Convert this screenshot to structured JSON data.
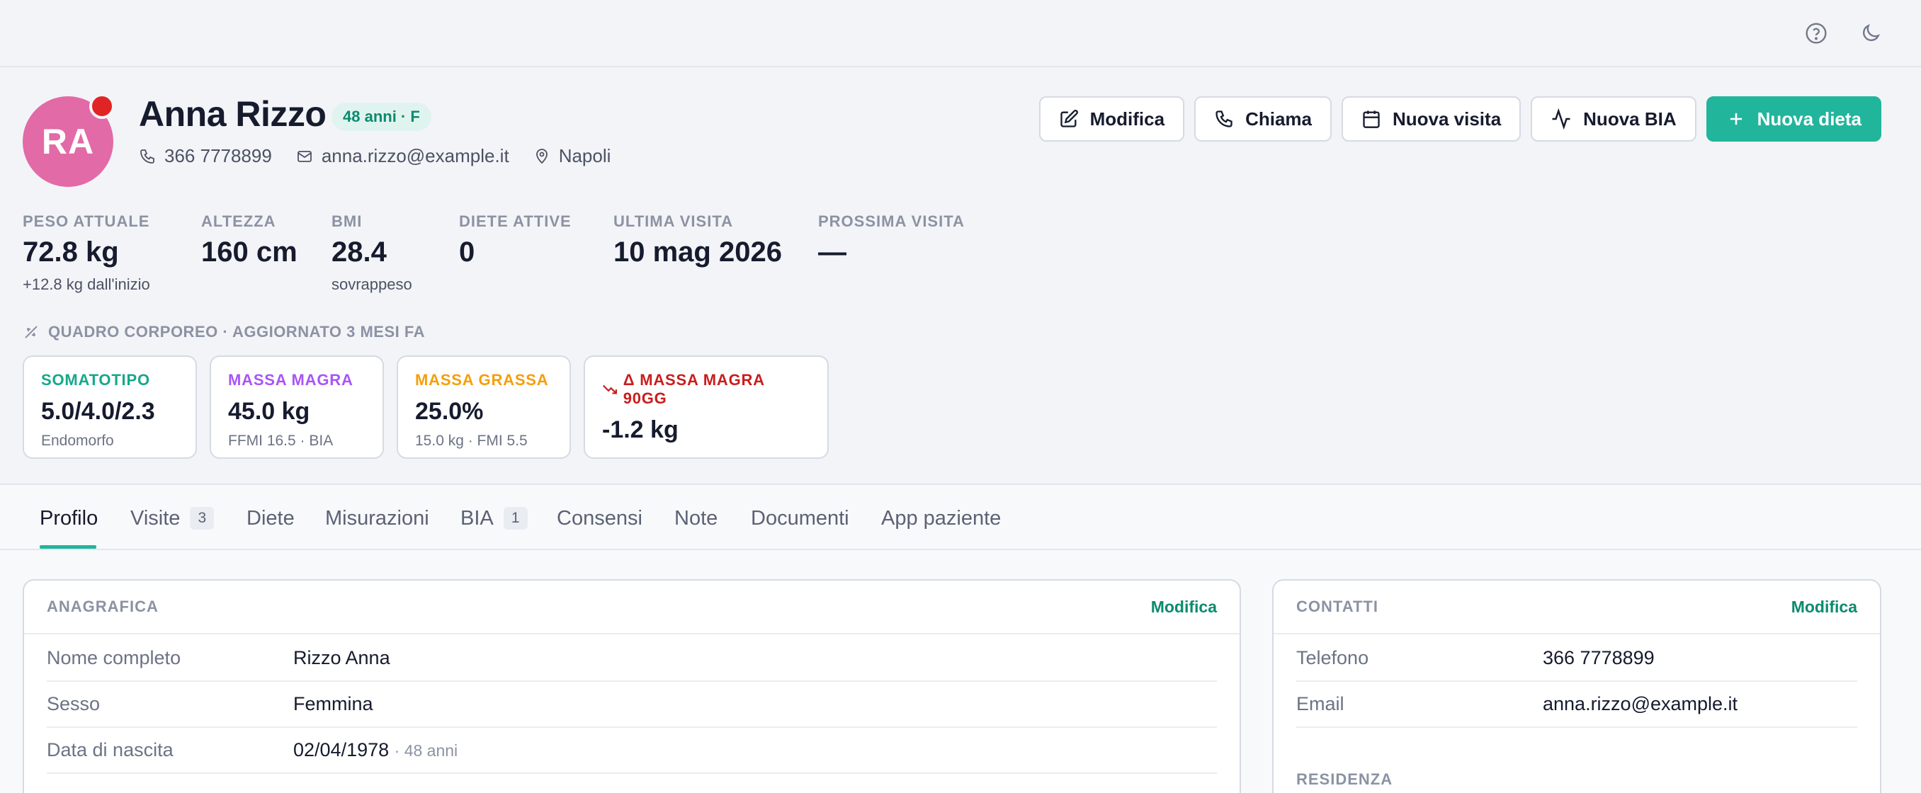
{
  "topbar": {
    "help_icon": "help-circle-icon",
    "theme_icon": "moon-icon"
  },
  "patient": {
    "initials": "RA",
    "name": "Anna Rizzo",
    "age_badge": "48 anni · F",
    "phone": "366 7778899",
    "email": "anna.rizzo@example.it",
    "city": "Napoli"
  },
  "actions": {
    "edit": "Modifica",
    "call": "Chiama",
    "new_visit": "Nuova visita",
    "new_bia": "Nuova BIA",
    "new_diet": "Nuova dieta"
  },
  "stats": [
    {
      "label": "PESO ATTUALE",
      "value": "72.8 kg",
      "sub": "+12.8 kg dall'inizio"
    },
    {
      "label": "ALTEZZA",
      "value": "160 cm",
      "sub": ""
    },
    {
      "label": "BMI",
      "value": "28.4",
      "sub": "sovrappeso"
    },
    {
      "label": "DIETE ATTIVE",
      "value": "0",
      "sub": ""
    },
    {
      "label": "ULTIMA VISITA",
      "value": "10 mag 2026",
      "sub": ""
    },
    {
      "label": "PROSSIMA VISITA",
      "value": "—",
      "sub": ""
    }
  ],
  "body_section": {
    "title": "QUADRO CORPOREO · AGGIORNATO 3 MESI FA"
  },
  "cards": [
    {
      "title": "SOMATOTIPO",
      "value": "5.0/4.0/2.3",
      "sub": "Endomorfo",
      "color": "#16a88a"
    },
    {
      "title": "MASSA MAGRA",
      "value": "45.0 kg",
      "sub": "FFMI 16.5 · BIA",
      "color": "#a855f7"
    },
    {
      "title": "MASSA GRASSA",
      "value": "25.0%",
      "sub": "15.0 kg · FMI 5.5",
      "color": "#f59e0b"
    },
    {
      "title": "Δ MASSA MAGRA 90GG",
      "value": "-1.2 kg",
      "sub": "",
      "color": "#c81e1e"
    }
  ],
  "tabs": [
    {
      "label": "Profilo",
      "count": ""
    },
    {
      "label": "Visite",
      "count": "3"
    },
    {
      "label": "Diete",
      "count": ""
    },
    {
      "label": "Misurazioni",
      "count": ""
    },
    {
      "label": "BIA",
      "count": "1"
    },
    {
      "label": "Consensi",
      "count": ""
    },
    {
      "label": "Note",
      "count": ""
    },
    {
      "label": "Documenti",
      "count": ""
    },
    {
      "label": "App paziente",
      "count": ""
    }
  ],
  "anagrafica": {
    "title": "ANAGRAFICA",
    "edit": "Modifica",
    "rows": [
      {
        "key": "Nome completo",
        "value": "Rizzo Anna",
        "extra": ""
      },
      {
        "key": "Sesso",
        "value": "Femmina",
        "extra": ""
      },
      {
        "key": "Data di nascita",
        "value": "02/04/1978",
        "extra": "· 48 anni"
      }
    ]
  },
  "contatti": {
    "title": "CONTATTI",
    "edit": "Modifica",
    "rows": [
      {
        "key": "Telefono",
        "value": "366 7778899"
      },
      {
        "key": "Email",
        "value": "anna.rizzo@example.it"
      }
    ],
    "residenza": "RESIDENZA"
  }
}
